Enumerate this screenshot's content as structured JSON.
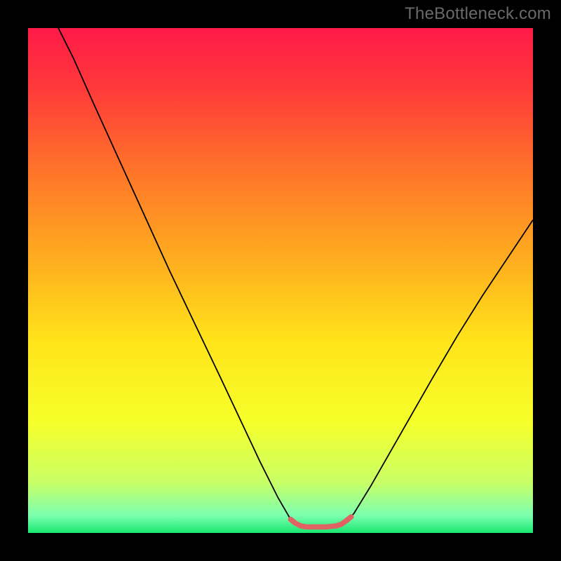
{
  "watermark": "TheBottleneck.com",
  "chart_data": {
    "type": "line",
    "title": "",
    "xlabel": "",
    "ylabel": "",
    "xlim": [
      0,
      100
    ],
    "ylim": [
      0,
      100
    ],
    "grid": false,
    "background_gradient": {
      "stops": [
        {
          "offset": 0.0,
          "color": "#ff1a47"
        },
        {
          "offset": 0.12,
          "color": "#ff3a3a"
        },
        {
          "offset": 0.3,
          "color": "#ff7a28"
        },
        {
          "offset": 0.48,
          "color": "#ffb41e"
        },
        {
          "offset": 0.62,
          "color": "#ffe41a"
        },
        {
          "offset": 0.78,
          "color": "#f6ff2a"
        },
        {
          "offset": 0.9,
          "color": "#c8ff66"
        },
        {
          "offset": 0.965,
          "color": "#7dffb0"
        },
        {
          "offset": 1.0,
          "color": "#18e870"
        }
      ]
    },
    "series": [
      {
        "name": "curve",
        "stroke": "#000000",
        "stroke_width": 1.8,
        "points": [
          {
            "x": 6.0,
            "y": 100.0
          },
          {
            "x": 9.0,
            "y": 94.0
          },
          {
            "x": 13.0,
            "y": 85.0
          },
          {
            "x": 18.0,
            "y": 74.0
          },
          {
            "x": 23.0,
            "y": 63.0
          },
          {
            "x": 28.0,
            "y": 52.0
          },
          {
            "x": 33.0,
            "y": 41.5
          },
          {
            "x": 38.0,
            "y": 31.0
          },
          {
            "x": 42.0,
            "y": 22.5
          },
          {
            "x": 46.0,
            "y": 14.0
          },
          {
            "x": 49.5,
            "y": 7.0
          },
          {
            "x": 52.0,
            "y": 2.7
          },
          {
            "x": 53.5,
            "y": 1.6
          },
          {
            "x": 55.0,
            "y": 1.2
          },
          {
            "x": 57.0,
            "y": 1.2
          },
          {
            "x": 59.0,
            "y": 1.2
          },
          {
            "x": 61.0,
            "y": 1.4
          },
          {
            "x": 62.5,
            "y": 1.9
          },
          {
            "x": 64.5,
            "y": 3.8
          },
          {
            "x": 68.0,
            "y": 9.5
          },
          {
            "x": 72.0,
            "y": 16.5
          },
          {
            "x": 76.0,
            "y": 23.5
          },
          {
            "x": 80.0,
            "y": 30.5
          },
          {
            "x": 85.0,
            "y": 39.0
          },
          {
            "x": 90.0,
            "y": 47.0
          },
          {
            "x": 95.0,
            "y": 54.5
          },
          {
            "x": 100.0,
            "y": 62.0
          }
        ]
      },
      {
        "name": "trough-marker",
        "stroke": "#e06262",
        "stroke_width": 7.5,
        "linecap": "round",
        "points": [
          {
            "x": 52.0,
            "y": 2.7
          },
          {
            "x": 53.0,
            "y": 1.9
          },
          {
            "x": 54.0,
            "y": 1.4
          },
          {
            "x": 55.0,
            "y": 1.2
          },
          {
            "x": 57.0,
            "y": 1.2
          },
          {
            "x": 59.0,
            "y": 1.2
          },
          {
            "x": 61.0,
            "y": 1.4
          },
          {
            "x": 62.0,
            "y": 1.7
          },
          {
            "x": 63.0,
            "y": 2.4
          },
          {
            "x": 64.0,
            "y": 3.2
          }
        ]
      }
    ]
  }
}
